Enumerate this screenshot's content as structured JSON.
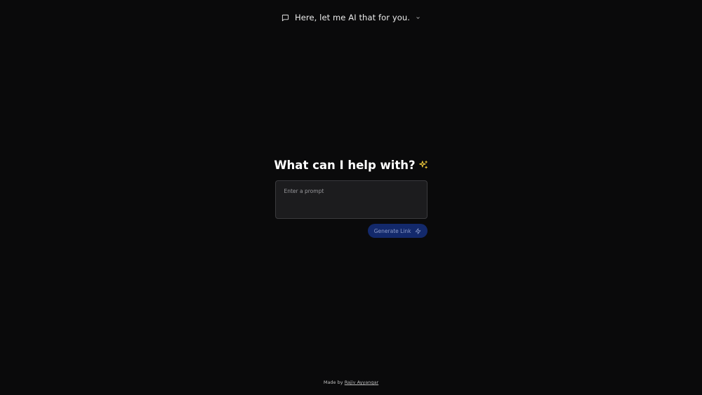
{
  "header": {
    "title": "Here, let me AI that for you.",
    "icons": {
      "left": "chat-bubble-icon",
      "right": "chevron-down-icon"
    }
  },
  "main": {
    "headline": "What can I help with?",
    "headline_icon": "sparkle-icon",
    "prompt": {
      "placeholder": "Enter a prompt",
      "value": ""
    },
    "generate_button": {
      "label": "Generate Link",
      "icon": "zap-icon"
    }
  },
  "footer": {
    "prefix": "Made by",
    "author": "Rajiv Ayyangar"
  },
  "colors": {
    "background": "#0a0a0b",
    "input_bg": "#1c1c1e",
    "button_bg": "#13296b",
    "sparkle": "#e8c33a"
  }
}
